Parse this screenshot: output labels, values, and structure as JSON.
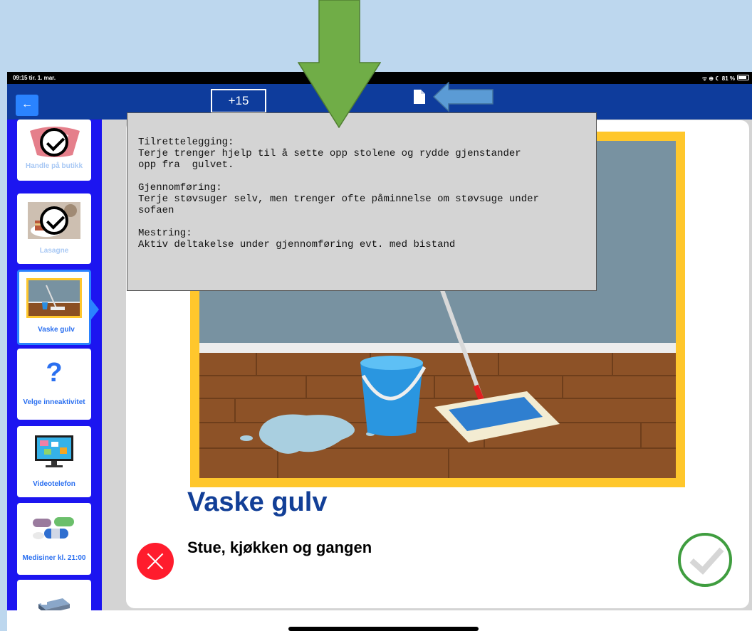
{
  "status_bar": {
    "time": "09:15  tir. 1. mar.",
    "right_text": "ᯤ ⊕ ☾ 81 %"
  },
  "navbar": {
    "back_label": "←",
    "time_shift_label": "+15"
  },
  "sidebar": {
    "items": [
      {
        "label": "Handle på butikk",
        "icon": "shopping-basket-icon",
        "status": "done"
      },
      {
        "label": "Lasagne",
        "icon": "lasagne-photo",
        "status": "done"
      },
      {
        "label": "Vaske gulv",
        "icon": "mop-floor-icon",
        "status": "selected"
      },
      {
        "label": "Velge inneaktivitet",
        "icon": "question-mark-icon",
        "glyph": "?",
        "status": "pending"
      },
      {
        "label": "Videotelefon",
        "icon": "monitor-icon",
        "status": "pending"
      },
      {
        "label": "Medisiner kl. 21:00",
        "icon": "pills-icon",
        "status": "pending"
      },
      {
        "label": "",
        "icon": "bed-icon",
        "status": "pending"
      }
    ]
  },
  "activity": {
    "title": "Vaske gulv",
    "subtitle": "Stue, kjøkken og gangen"
  },
  "tooltip": {
    "paragraphs": [
      "Tilrettelegging:\nTerje trenger hjelp til å sette opp stolene og rydde gjenstander\nopp fra  gulvet.",
      "Gjennomføring:\nTerje støvsuger selv, men trenger ofte påminnelse om støvsuge under\nsofaen",
      "Mestring:\nAktiv deltakelse under gjennomføring evt. med bistand"
    ]
  },
  "colors": {
    "nav_blue": "#0e3c9c",
    "sidebar_blue": "#1c15f0",
    "accent_blue": "#2a83ff",
    "title_blue": "#123f97",
    "frame_yellow": "#ffc72c",
    "cancel_red": "#ff1c2d",
    "done_green": "#3f9d3f",
    "annotation_green": "#70ad47",
    "annotation_blue": "#5b9bd5"
  }
}
